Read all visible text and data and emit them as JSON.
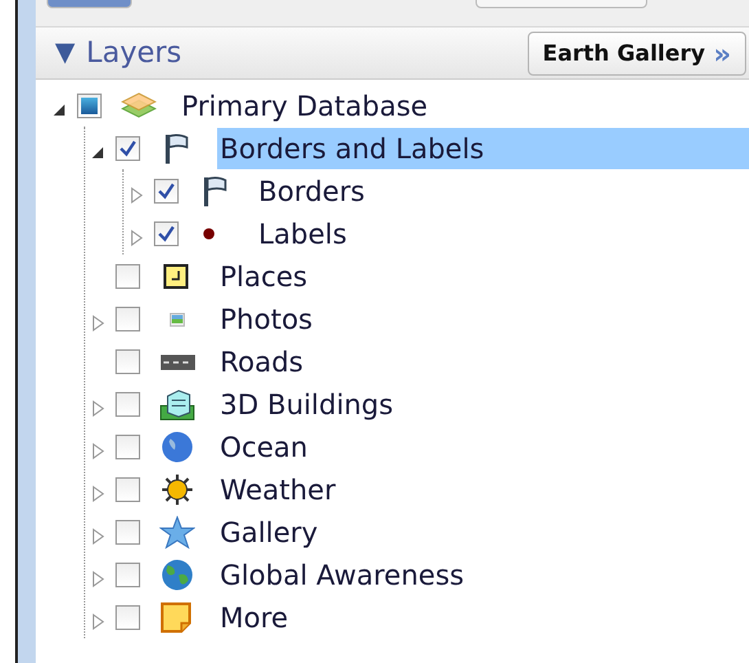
{
  "panel": {
    "toggle": "▼",
    "title": "Layers",
    "gallery_button": {
      "label": "Earth Gallery",
      "arrow": "»"
    }
  },
  "tree": [
    {
      "label": "Primary Database",
      "kind": "layers",
      "mixed": true,
      "expanded": true,
      "selected": false,
      "children": [
        {
          "label": "Borders and Labels",
          "kind": "flag",
          "checked": true,
          "expanded": true,
          "selected": true,
          "children": [
            {
              "label": "Borders",
              "kind": "flag",
              "checked": true,
              "expanded": false,
              "selected": false
            },
            {
              "label": "Labels",
              "kind": "dot",
              "checked": true,
              "expanded": false,
              "selected": false
            }
          ]
        },
        {
          "label": "Places",
          "kind": "places",
          "checked": false,
          "selected": false
        },
        {
          "label": "Photos",
          "kind": "photo",
          "checked": false,
          "expanded": false,
          "selected": false
        },
        {
          "label": "Roads",
          "kind": "road",
          "checked": false,
          "selected": false
        },
        {
          "label": "3D Buildings",
          "kind": "building",
          "checked": false,
          "expanded": false,
          "selected": false
        },
        {
          "label": "Ocean",
          "kind": "ocean",
          "checked": false,
          "expanded": false,
          "selected": false
        },
        {
          "label": "Weather",
          "kind": "sun",
          "checked": false,
          "expanded": false,
          "selected": false
        },
        {
          "label": "Gallery",
          "kind": "star",
          "checked": false,
          "expanded": false,
          "selected": false
        },
        {
          "label": "Global Awareness",
          "kind": "globe",
          "checked": false,
          "expanded": false,
          "selected": false
        },
        {
          "label": "More",
          "kind": "note",
          "checked": false,
          "expanded": false,
          "selected": false
        }
      ]
    }
  ]
}
